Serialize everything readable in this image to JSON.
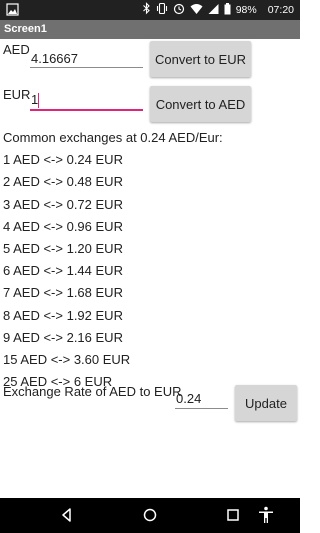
{
  "status_bar": {
    "battery": "98%",
    "time": "07:20",
    "icons": [
      "image-icon",
      "bluetooth-icon",
      "vibrate-icon",
      "alarm-icon",
      "wifi-icon",
      "signal-icon",
      "battery-icon"
    ]
  },
  "title": "Screen1",
  "aed": {
    "label": "AED",
    "value": "4.16667",
    "button": "Convert to EUR"
  },
  "eur": {
    "label": "EUR",
    "value": "1",
    "button": "Convert to AED"
  },
  "common_heading": "Common exchanges at 0.24 AED/Eur:",
  "exchanges": [
    "1 AED <-> 0.24 EUR",
    "2 AED <-> 0.48 EUR",
    "3 AED <-> 0.72 EUR",
    "4 AED <-> 0.96 EUR",
    "5 AED <-> 1.20 EUR",
    "6 AED <-> 1.44 EUR",
    "7 AED <-> 1.68 EUR",
    "8 AED <-> 1.92 EUR",
    "9 AED <-> 2.16 EUR",
    "15 AED <-> 3.60 EUR",
    "25 AED <-> 6 EUR"
  ],
  "rate": {
    "label": "Exchange Rate of AED to EUR",
    "value": "0.24",
    "button": "Update"
  },
  "nav": {
    "icons": [
      "back-icon",
      "home-icon",
      "recents-icon",
      "accessibility-icon"
    ]
  },
  "colors": {
    "accent": "#e0247a",
    "title_bar": "#707070",
    "status_bar": "#212121",
    "button": "#d6d6d6"
  }
}
